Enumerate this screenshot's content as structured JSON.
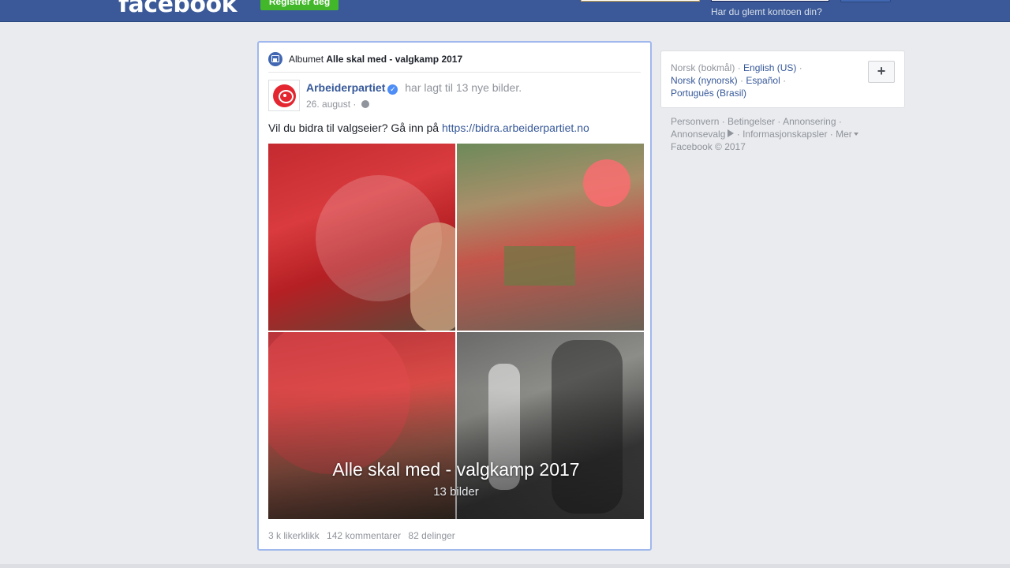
{
  "header": {
    "logo": "facebook",
    "register_label": "Registrer deg",
    "forgot_label": "Har du glemt kontoen din?"
  },
  "post": {
    "album_prefix": "Albumet",
    "album_name": "Alle skal med - valgkamp 2017",
    "author": "Arbeiderpartiet",
    "action": "har lagt til 13 nye bilder.",
    "date": "26. august",
    "date_sep": "·",
    "text": "Vil du bidra til valgseier? Gå inn på",
    "link": "https://bidra.arbeiderpartiet.no",
    "album_title": "Alle skal med - valgkamp 2017",
    "photo_count": "13 bilder",
    "likes": "3 k likerklikk",
    "comments": "142 kommentarer",
    "shares": "82 delinger"
  },
  "languages": {
    "current": "Norsk (bokmål)",
    "items": [
      "English (US)",
      "Norsk (nynorsk)",
      "Español",
      "Português (Brasil)"
    ],
    "sep": "·",
    "add_label": "+"
  },
  "footer": {
    "links": [
      "Personvern",
      "Betingelser",
      "Annonsering",
      "Annonsevalg",
      "Informasjonskapsler",
      "Mer"
    ],
    "copyright": "Facebook © 2017"
  },
  "colors": {
    "brand_blue": "#3b5998",
    "link_blue": "#365899",
    "register_green": "#42b72a",
    "page_bg": "#e9ebee"
  }
}
